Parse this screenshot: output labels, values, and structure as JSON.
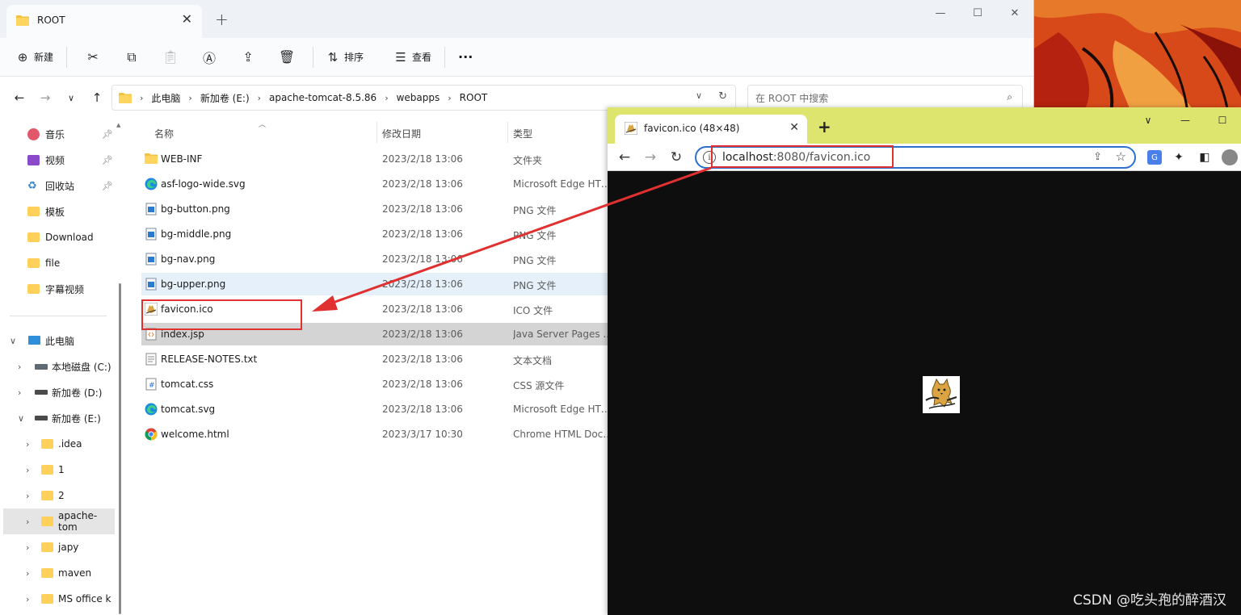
{
  "explorer": {
    "tab_title": "ROOT",
    "toolbar": {
      "new_label": "新建",
      "sort_label": "排序",
      "view_label": "查看",
      "more_label": "···"
    },
    "breadcrumbs": [
      "此电脑",
      "新加卷 (E:)",
      "apache-tomcat-8.5.86",
      "webapps",
      "ROOT"
    ],
    "search_placeholder": "在 ROOT 中搜索",
    "sidebar": {
      "quick": [
        {
          "label": "音乐",
          "icon": "music-icon"
        },
        {
          "label": "视频",
          "icon": "video-icon"
        },
        {
          "label": "回收站",
          "icon": "recycle-bin-icon"
        },
        {
          "label": "模板",
          "icon": "folder-icon"
        },
        {
          "label": "Download",
          "icon": "folder-icon"
        },
        {
          "label": "file",
          "icon": "folder-icon"
        },
        {
          "label": "字幕视频",
          "icon": "folder-icon"
        }
      ],
      "tree": [
        {
          "label": "此电脑",
          "icon": "pc-icon"
        },
        {
          "label": "本地磁盘 (C:)",
          "icon": "drive-icon"
        },
        {
          "label": "新加卷 (D:)",
          "icon": "drive-icon"
        },
        {
          "label": "新加卷 (E:)",
          "icon": "drive-icon"
        },
        {
          "label": ".idea",
          "icon": "folder-icon"
        },
        {
          "label": "1",
          "icon": "folder-icon"
        },
        {
          "label": "2",
          "icon": "folder-icon"
        },
        {
          "label": "apache-tom",
          "icon": "folder-icon"
        },
        {
          "label": "japy",
          "icon": "folder-icon"
        },
        {
          "label": "maven",
          "icon": "folder-icon"
        },
        {
          "label": "MS office k",
          "icon": "folder-icon"
        }
      ]
    },
    "columns": {
      "name": "名称",
      "date": "修改日期",
      "type": "类型"
    },
    "files": [
      {
        "name": "WEB-INF",
        "date": "2023/2/18 13:06",
        "type": "文件夹",
        "icon": "folder-icon"
      },
      {
        "name": "asf-logo-wide.svg",
        "date": "2023/2/18 13:06",
        "type": "Microsoft Edge HTML Document",
        "icon": "edge-icon"
      },
      {
        "name": "bg-button.png",
        "date": "2023/2/18 13:06",
        "type": "PNG 文件",
        "icon": "image-file-icon"
      },
      {
        "name": "bg-middle.png",
        "date": "2023/2/18 13:06",
        "type": "PNG 文件",
        "icon": "image-file-icon"
      },
      {
        "name": "bg-nav.png",
        "date": "2023/2/18 13:06",
        "type": "PNG 文件",
        "icon": "image-file-icon"
      },
      {
        "name": "bg-upper.png",
        "date": "2023/2/18 13:06",
        "type": "PNG 文件",
        "icon": "image-file-icon"
      },
      {
        "name": "favicon.ico",
        "date": "2023/2/18 13:06",
        "type": "ICO 文件",
        "icon": "tomcat-favicon-icon"
      },
      {
        "name": "index.jsp",
        "date": "2023/2/18 13:06",
        "type": "Java Server Pages ...",
        "icon": "code-file-icon"
      },
      {
        "name": "RELEASE-NOTES.txt",
        "date": "2023/2/18 13:06",
        "type": "文本文档",
        "icon": "text-file-icon"
      },
      {
        "name": "tomcat.css",
        "date": "2023/2/18 13:06",
        "type": "CSS 源文件",
        "icon": "css-file-icon"
      },
      {
        "name": "tomcat.svg",
        "date": "2023/2/18 13:06",
        "type": "Microsoft Edge HTML Document",
        "icon": "edge-icon"
      },
      {
        "name": "welcome.html",
        "date": "2023/3/17 10:30",
        "type": "Chrome HTML Document",
        "icon": "chrome-icon"
      }
    ]
  },
  "browser": {
    "tab_title": "favicon.ico (48×48)",
    "url_host": "localhost",
    "url_rest": ":8080/favicon.ico"
  },
  "watermark": "CSDN @吃头孢的醉酒汉",
  "colors": {
    "annotation_red": "#e03030",
    "chrome_frame": "#dee56f",
    "omnibox_focus": "#2b6fcf",
    "viewer_bg": "#0e0e0e"
  }
}
